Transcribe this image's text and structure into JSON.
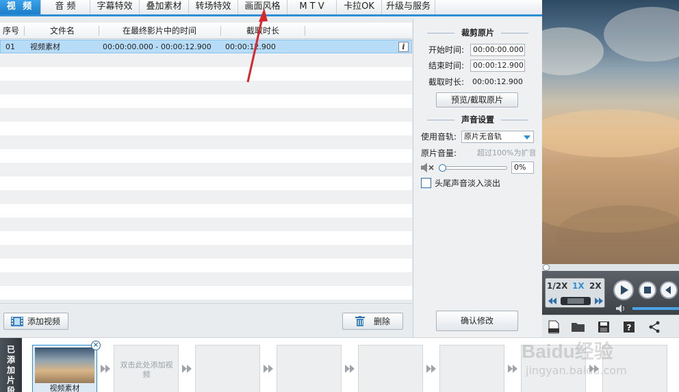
{
  "tabs": [
    {
      "label": "视 频",
      "active": true
    },
    {
      "label": "音 频",
      "active": false
    },
    {
      "label": "字幕特效",
      "active": false
    },
    {
      "label": "叠加素材",
      "active": false
    },
    {
      "label": "转场特效",
      "active": false
    },
    {
      "label": "画面风格",
      "active": false
    },
    {
      "label": "M T V",
      "active": false
    },
    {
      "label": "卡拉OK",
      "active": false
    },
    {
      "label": "升级与服务",
      "active": false
    }
  ],
  "table": {
    "headers": [
      "序号",
      "文件名",
      "在最终影片中的时间",
      "截取时长"
    ],
    "rows": [
      {
        "index": "01",
        "name": "视频素材",
        "time": "00:00:00.000 - 00:00:12.900",
        "duration": "00:00:12.900",
        "info": "i"
      }
    ]
  },
  "footer": {
    "add_video": "添加视频",
    "delete": "删除"
  },
  "clip": {
    "title": "裁剪原片",
    "start_label": "开始时间:",
    "start_value": "00:00:00.000",
    "end_label": "结束时间:",
    "end_value": "00:00:12.900",
    "duration_label": "截取时长:",
    "duration_value": "00:00:12.900",
    "preview_button": "预览/截取原片"
  },
  "audio": {
    "title": "声音设置",
    "track_label": "使用音轨:",
    "track_value": "原片无音轨",
    "volume_label": "原片音量:",
    "volume_hint": "超过100%为扩音",
    "volume_value": "0%",
    "volume_level": 0,
    "fade_label": "头尾声音淡入淡出",
    "fade_checked": false
  },
  "confirm_button": "确认修改",
  "player": {
    "speeds": [
      "1/2X",
      "1X",
      "2X"
    ],
    "active_speed": "1X"
  },
  "strip": {
    "label": "已添加片段",
    "clip_name": "视频素材",
    "placeholder": "双击此处添加视频"
  },
  "watermark": {
    "logo": "Baidu经验",
    "url": "jingyan.baidu.com"
  },
  "colors": {
    "accent": "#2d8fd5",
    "selection": "#b7dcf8",
    "annotation_arrow": "#d9262a"
  }
}
